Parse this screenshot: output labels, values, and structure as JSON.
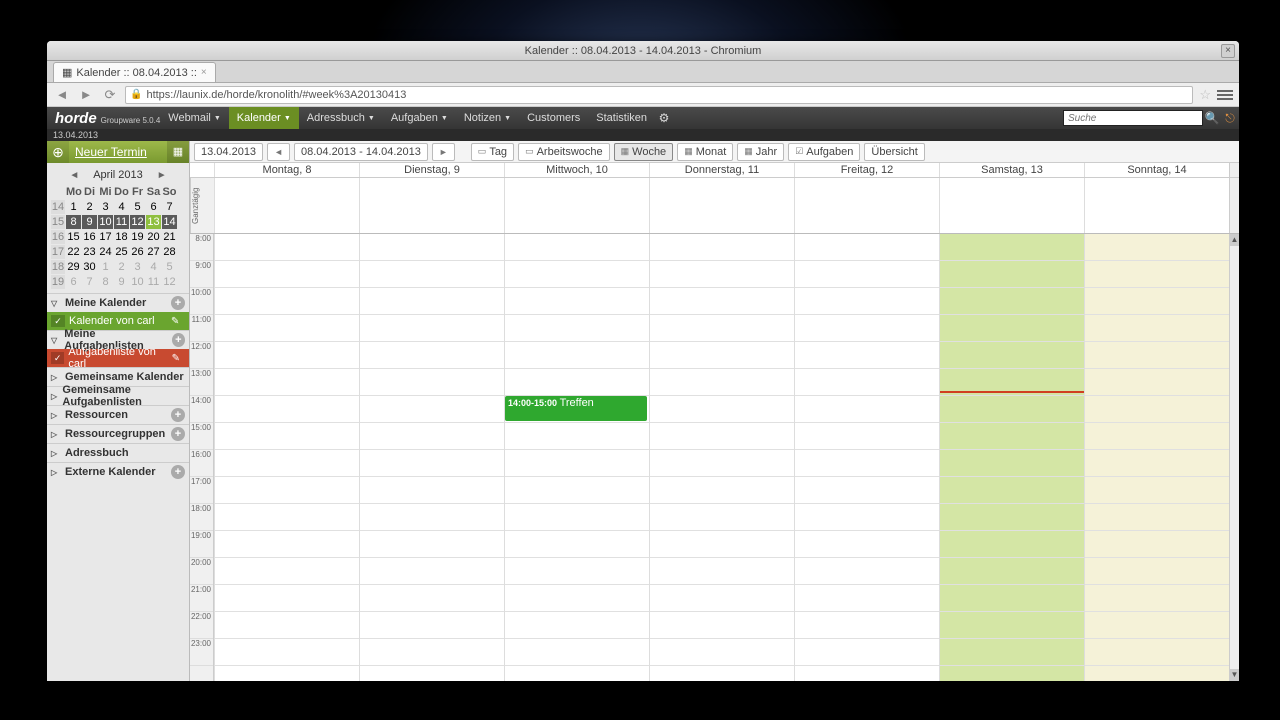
{
  "window": {
    "title": "Kalender :: 08.04.2013 - 14.04.2013 - Chromium"
  },
  "tab": {
    "title": "Kalender :: 08.04.2013 ::"
  },
  "url": "https://launix.de/horde/kronolith/#week%3A20130413",
  "horde": {
    "brand": "horde",
    "sub": "Groupware 5.0.4",
    "menu": [
      "Webmail",
      "Kalender",
      "Adressbuch",
      "Aufgaben",
      "Notizen",
      "Customers",
      "Statistiken"
    ],
    "active": 1,
    "search_placeholder": "Suche"
  },
  "date_strip": "13.04.2013",
  "new_event": "Neuer Termin",
  "minical": {
    "month": "April 2013",
    "dow": [
      "Mo",
      "Di",
      "Mi",
      "Do",
      "Fr",
      "Sa",
      "So"
    ],
    "weeks": [
      {
        "wk": "14",
        "days": [
          "1",
          "2",
          "3",
          "4",
          "5",
          "6",
          "7"
        ],
        "class": [
          "",
          "",
          "",
          "",
          "",
          "",
          ""
        ]
      },
      {
        "wk": "15",
        "days": [
          "8",
          "9",
          "10",
          "11",
          "12",
          "13",
          "14"
        ],
        "class": [
          "cur",
          "cur",
          "cur",
          "cur",
          "cur",
          "today",
          "cur"
        ]
      },
      {
        "wk": "16",
        "days": [
          "15",
          "16",
          "17",
          "18",
          "19",
          "20",
          "21"
        ],
        "class": [
          "",
          "",
          "",
          "",
          "",
          "",
          ""
        ]
      },
      {
        "wk": "17",
        "days": [
          "22",
          "23",
          "24",
          "25",
          "26",
          "27",
          "28"
        ],
        "class": [
          "",
          "",
          "",
          "",
          "",
          "",
          ""
        ]
      },
      {
        "wk": "18",
        "days": [
          "29",
          "30",
          "1",
          "2",
          "3",
          "4",
          "5"
        ],
        "class": [
          "",
          "",
          "od",
          "od",
          "od",
          "od",
          "od"
        ]
      },
      {
        "wk": "19",
        "days": [
          "6",
          "7",
          "8",
          "9",
          "10",
          "11",
          "12"
        ],
        "class": [
          "od",
          "od",
          "od",
          "od",
          "od",
          "od",
          "od"
        ]
      }
    ]
  },
  "sidebar": {
    "sections": [
      {
        "label": "Meine Kalender",
        "open": true,
        "add": true,
        "items": [
          {
            "label": "Kalender von carl",
            "cls": "si-green"
          }
        ]
      },
      {
        "label": "Meine Aufgabenlisten",
        "open": true,
        "add": true,
        "items": [
          {
            "label": "Aufgabenliste von carl",
            "cls": "si-red"
          }
        ]
      },
      {
        "label": "Gemeinsame Kalender",
        "open": false,
        "add": false,
        "items": []
      },
      {
        "label": "Gemeinsame Aufgabenlisten",
        "open": false,
        "add": false,
        "items": []
      },
      {
        "label": "Ressourcen",
        "open": false,
        "add": true,
        "items": []
      },
      {
        "label": "Ressourcegruppen",
        "open": false,
        "add": true,
        "items": []
      },
      {
        "label": "Adressbuch",
        "open": false,
        "add": false,
        "items": []
      },
      {
        "label": "Externe Kalender",
        "open": false,
        "add": true,
        "items": []
      }
    ]
  },
  "viewbar": {
    "date": "13.04.2013",
    "range": "08.04.2013 - 14.04.2013",
    "buttons": [
      "Tag",
      "Arbeitswoche",
      "Woche",
      "Monat",
      "Jahr",
      "Aufgaben",
      "Übersicht"
    ],
    "selected": 2
  },
  "days": [
    "Montag, 8",
    "Dienstag, 9",
    "Mittwoch, 10",
    "Donnerstag, 11",
    "Freitag, 12",
    "Samstag, 13",
    "Sonntag, 14"
  ],
  "allday_label": "Ganztägig",
  "hours": [
    "8:00",
    "9:00",
    "10:00",
    "11:00",
    "12:00",
    "13:00",
    "14:00",
    "15:00",
    "16:00",
    "17:00",
    "18:00",
    "19:00",
    "20:00",
    "21:00",
    "22:00",
    "23:00"
  ],
  "events": [
    {
      "day": 2,
      "start_idx": 6,
      "span": 1,
      "time": "14:00-15:00",
      "title": "Treffen"
    }
  ],
  "now_line_idx": 6,
  "now_line_day": 5
}
